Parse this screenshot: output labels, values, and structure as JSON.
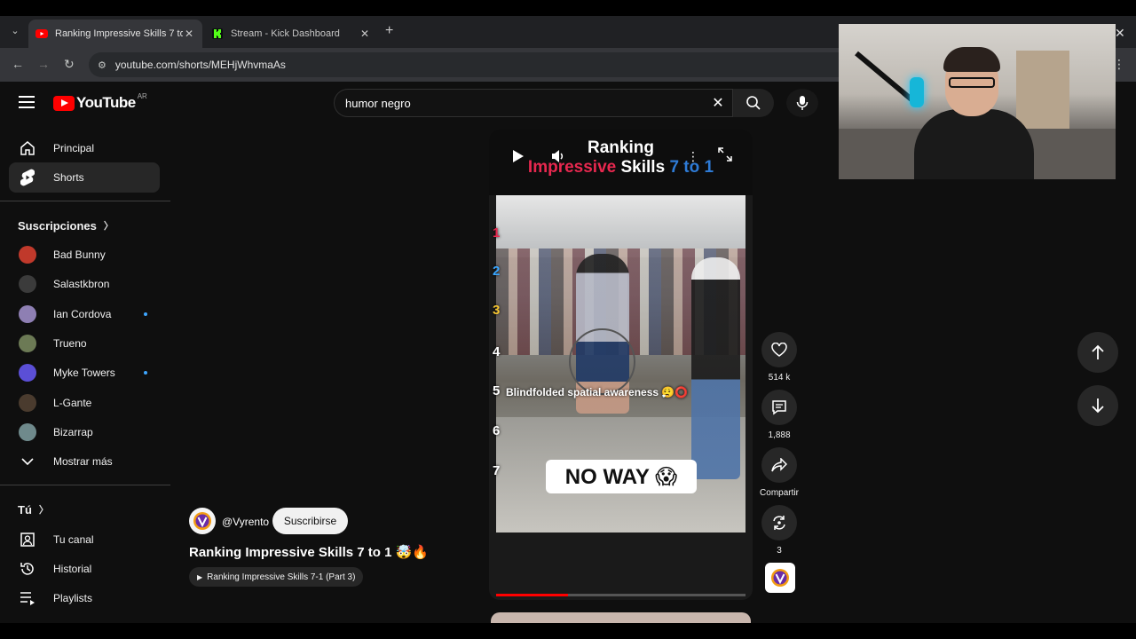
{
  "browser": {
    "tabs": [
      {
        "title": "Ranking Impressive Skills 7 to 1",
        "active": true
      },
      {
        "title": "Stream - Kick Dashboard",
        "active": false
      }
    ],
    "url": "youtube.com/shorts/MEHjWhvmaAs"
  },
  "youtube": {
    "logo_text": "YouTube",
    "country": "AR",
    "search": {
      "query": "humor negro"
    }
  },
  "sidebar": {
    "main": [
      {
        "label": "Principal",
        "icon": "home-icon"
      },
      {
        "label": "Shorts",
        "icon": "shorts-icon",
        "active": true
      }
    ],
    "subscriptions_heading": "Suscripciones",
    "subscriptions": [
      {
        "label": "Bad Bunny",
        "color": "#c0392b",
        "new": false
      },
      {
        "label": "Salastkbron",
        "color": "#3b3b3b",
        "new": false
      },
      {
        "label": "Ian Cordova",
        "color": "#8e7fb3",
        "new": true
      },
      {
        "label": "Trueno",
        "color": "#6c7a55",
        "new": false
      },
      {
        "label": "Myke Towers",
        "color": "#5b4fd6",
        "new": true
      },
      {
        "label": "L-Gante",
        "color": "#4a3b2e",
        "new": false
      },
      {
        "label": "Bizarrap",
        "color": "#6f8a8c",
        "new": false
      }
    ],
    "show_more": "Mostrar más",
    "you_heading": "Tú",
    "you_items": [
      {
        "label": "Tu canal",
        "icon": "channel-icon"
      },
      {
        "label": "Historial",
        "icon": "history-icon"
      },
      {
        "label": "Playlists",
        "icon": "playlists-icon"
      }
    ]
  },
  "short": {
    "overlay_title_line1": "Ranking",
    "overlay_title_word_pink": "Impressive",
    "overlay_title_word_white": "Skills",
    "overlay_title_word_blue": "7 to 1",
    "ranks": [
      "1",
      "2",
      "3",
      "4",
      "5",
      "6",
      "7"
    ],
    "caption": "Blindfolded spatial awareness 😮‍💨⭕",
    "banner": "NO WAY 😱",
    "progress": 0.29
  },
  "actions": {
    "likes": "514 k",
    "comments": "1,888",
    "share": "Compartir",
    "remix": "3"
  },
  "channel": {
    "handle": "@Vyrento",
    "subscribe": "Suscribirse",
    "title": "Ranking Impressive Skills 7 to 1 🤯🔥",
    "playlist": "Ranking Impressive Skills 7-1 (Part 3)"
  },
  "colors": {
    "youtube_red": "#ff0000",
    "kick_green": "#53fc18",
    "accent_blue": "#3ea6ff"
  }
}
